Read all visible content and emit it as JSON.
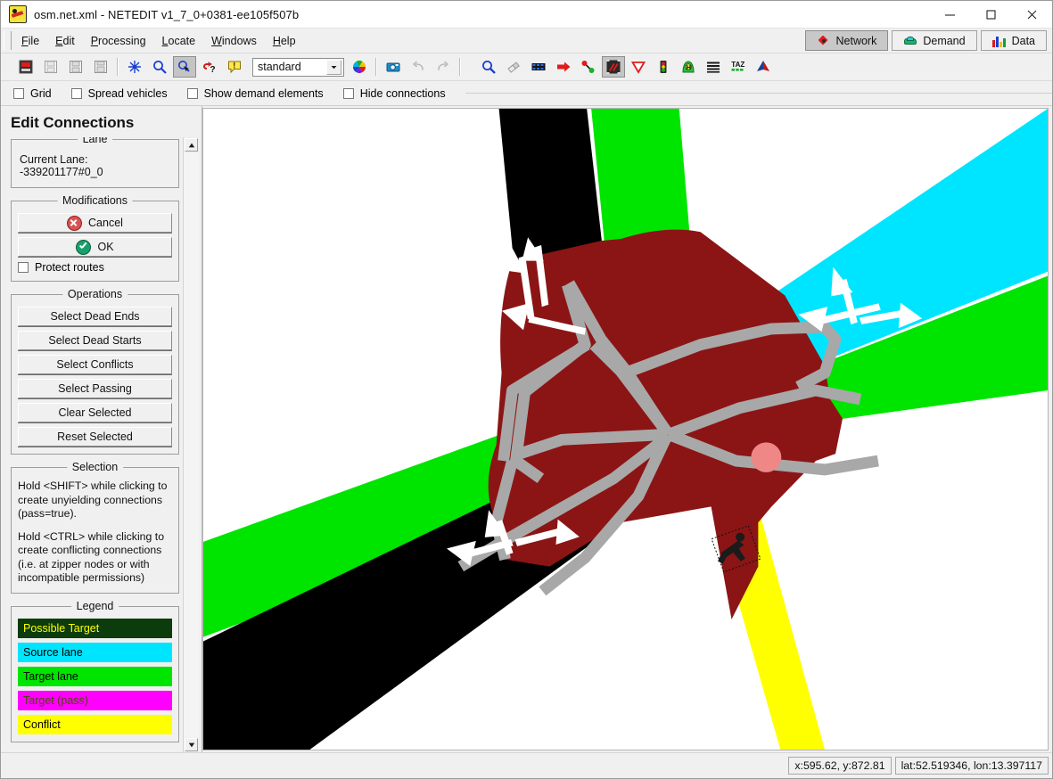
{
  "window": {
    "title": "osm.net.xml - NETEDIT v1_7_0+0381-ee105f507b",
    "app_icon": "netedit-icon",
    "minimize": "–",
    "maximize": "□",
    "close": "✕"
  },
  "menu": {
    "items": [
      {
        "label": "File",
        "mnemonic": "F"
      },
      {
        "label": "Edit",
        "mnemonic": "E"
      },
      {
        "label": "Processing",
        "mnemonic": "P"
      },
      {
        "label": "Locate",
        "mnemonic": "L"
      },
      {
        "label": "Windows",
        "mnemonic": "W"
      },
      {
        "label": "Help",
        "mnemonic": "H"
      }
    ]
  },
  "mode_tabs": [
    {
      "label": "Network",
      "icon": "network-node-icon",
      "active": true
    },
    {
      "label": "Demand",
      "icon": "vehicle-icon",
      "active": false
    },
    {
      "label": "Data",
      "icon": "bar-chart-icon",
      "active": false
    }
  ],
  "toolbar": {
    "groups": [
      {
        "buttons": [
          {
            "name": "new-network-button",
            "icon": "new-network-icon"
          },
          {
            "name": "open-network-button",
            "icon": "open-folder-icon"
          },
          {
            "name": "save-network-button",
            "icon": "save-disk-icon"
          },
          {
            "name": "save-network-as-button",
            "icon": "save-as-disk-icon"
          }
        ]
      },
      {
        "buttons": [
          {
            "name": "recenter-view-button",
            "icon": "recenter-icon"
          },
          {
            "name": "zoom-style-button",
            "icon": "magnifier-icon"
          },
          {
            "name": "edit-viewport-button",
            "icon": "viewport-cursor-icon",
            "pressed": true
          },
          {
            "name": "toggle-grid-button",
            "icon": "red-question-icon"
          },
          {
            "name": "show-tooltips-button",
            "icon": "tooltip-icon"
          }
        ]
      },
      {
        "scheme_combo": {
          "value": "standard",
          "name": "coloring-scheme-combo"
        },
        "buttons": [
          {
            "name": "edit-coloring-button",
            "icon": "color-wheel-icon"
          },
          {
            "name": "make-snapshot-button",
            "icon": "camera-icon"
          },
          {
            "name": "undo-button",
            "icon": "undo-arrow-icon",
            "disabled": true
          },
          {
            "name": "redo-button",
            "icon": "redo-arrow-icon",
            "disabled": true
          }
        ]
      },
      {
        "buttons": [
          {
            "name": "inspect-mode-button",
            "icon": "magnifier-icon"
          },
          {
            "name": "delete-mode-button",
            "icon": "eraser-icon"
          },
          {
            "name": "select-mode-button",
            "icon": "select-road-icon"
          },
          {
            "name": "move-mode-button",
            "icon": "red-arrow-icon"
          },
          {
            "name": "create-edge-button",
            "icon": "edge-nodes-icon"
          },
          {
            "name": "connection-mode-button",
            "icon": "connection-icon",
            "pressed": true
          },
          {
            "name": "prohibition-mode-button",
            "icon": "yield-triangle-icon"
          },
          {
            "name": "traffic-light-button",
            "icon": "traffic-light-icon"
          },
          {
            "name": "additional-mode-button",
            "icon": "additional-icon"
          },
          {
            "name": "crossing-mode-button",
            "icon": "crossing-stripes-icon"
          },
          {
            "name": "taz-mode-button",
            "icon": "taz-icon"
          },
          {
            "name": "shape-mode-button",
            "icon": "polygon-icon"
          }
        ]
      }
    ]
  },
  "view_options": [
    {
      "label": "Grid",
      "checked": false,
      "name": "grid-checkbox"
    },
    {
      "label": "Spread vehicles",
      "checked": false,
      "name": "spread-vehicles-checkbox"
    },
    {
      "label": "Show demand elements",
      "checked": false,
      "name": "show-demand-elements-checkbox"
    },
    {
      "label": "Hide connections",
      "checked": false,
      "name": "hide-connections-checkbox"
    }
  ],
  "panel": {
    "title": "Edit Connections",
    "lane": {
      "group_label": "Lane",
      "current_lane_text": "Current Lane: -339201177#0_0"
    },
    "modifications": {
      "group_label": "Modifications",
      "cancel_label": "Cancel",
      "ok_label": "OK",
      "protect_routes_label": "Protect routes",
      "protect_routes_checked": false
    },
    "operations": {
      "group_label": "Operations",
      "buttons": [
        "Select Dead Ends",
        "Select Dead Starts",
        "Select Conflicts",
        "Select Passing",
        "Clear Selected",
        "Reset Selected"
      ]
    },
    "selection": {
      "group_label": "Selection",
      "paragraphs": [
        "Hold <SHIFT> while clicking to create unyielding connections (pass=true).",
        "Hold <CTRL> while clicking to create conflicting connections (i.e. at zipper nodes or with incompatible permissions)"
      ]
    },
    "legend": {
      "group_label": "Legend",
      "entries": [
        {
          "label": "Possible Target",
          "bg": "#0c3b0c",
          "fg": "#ffff00"
        },
        {
          "label": "Source lane",
          "bg": "#00e5ff",
          "fg": "#000000"
        },
        {
          "label": "Target lane",
          "bg": "#00e500",
          "fg": "#000000"
        },
        {
          "label": "Target (pass)",
          "bg": "#ff00ff",
          "fg": "#4a4a00"
        },
        {
          "label": "Conflict",
          "bg": "#ffff00",
          "fg": "#000000"
        }
      ]
    },
    "scrollbar": {
      "up": "▲",
      "down": "▼",
      "name": "panel-vertical-scrollbar"
    }
  },
  "canvas": {
    "name": "network-view-canvas",
    "background": "#ffffff",
    "colors": {
      "junction": "#8b1515",
      "internal_lane": "#a8a8a8",
      "source_lane": "#00e5ff",
      "target_lane": "#00e500",
      "normal_lane": "#000000",
      "sidewalk": "#ffff00",
      "marker": "#ef8787",
      "arrow": "#ffffff"
    }
  },
  "status": {
    "cursor_position": "x:595.62, y:872.81",
    "geo_position": "lat:52.519346, lon:13.397117"
  }
}
